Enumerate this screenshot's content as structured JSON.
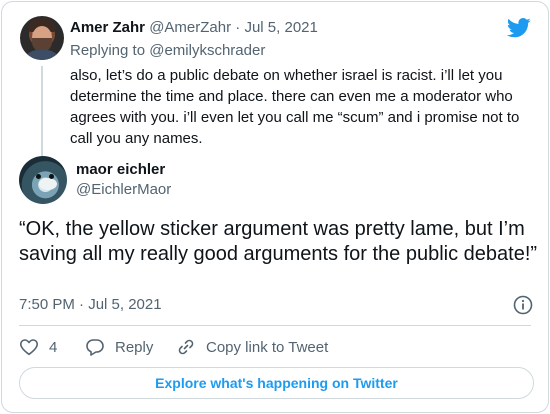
{
  "parent_tweet": {
    "name": "Amer Zahr",
    "handle": "@AmerZahr",
    "separator": "·",
    "date": "Jul 5, 2021",
    "replying_prefix": "Replying to ",
    "replying_to": "@emilykschrader",
    "text": "also, let’s do a public debate on whether israel is racist. i’ll let you determine the time and place. there can even me a moderator who agrees with you. i’ll even let you call me “scum” and i promise not to call you any names."
  },
  "main_tweet": {
    "name": "maor eichler",
    "handle": "@EichlerMaor",
    "text": "“OK, the yellow sticker argument was pretty lame, but I’m saving all my really good arguments for the public debate!”",
    "timestamp": "7:50 PM · Jul 5, 2021"
  },
  "actions": {
    "like_count": "4",
    "reply_label": "Reply",
    "copy_link_label": "Copy link to Tweet"
  },
  "explore_button": "Explore what's happening on Twitter",
  "icons": {
    "brand": "twitter-bird-icon",
    "info": "info-icon",
    "like": "heart-icon",
    "reply": "reply-bubble-icon",
    "copy": "link-icon"
  },
  "colors": {
    "brand": "#1d9bf0",
    "secondary_text": "#536471",
    "border": "#cfd9de"
  }
}
